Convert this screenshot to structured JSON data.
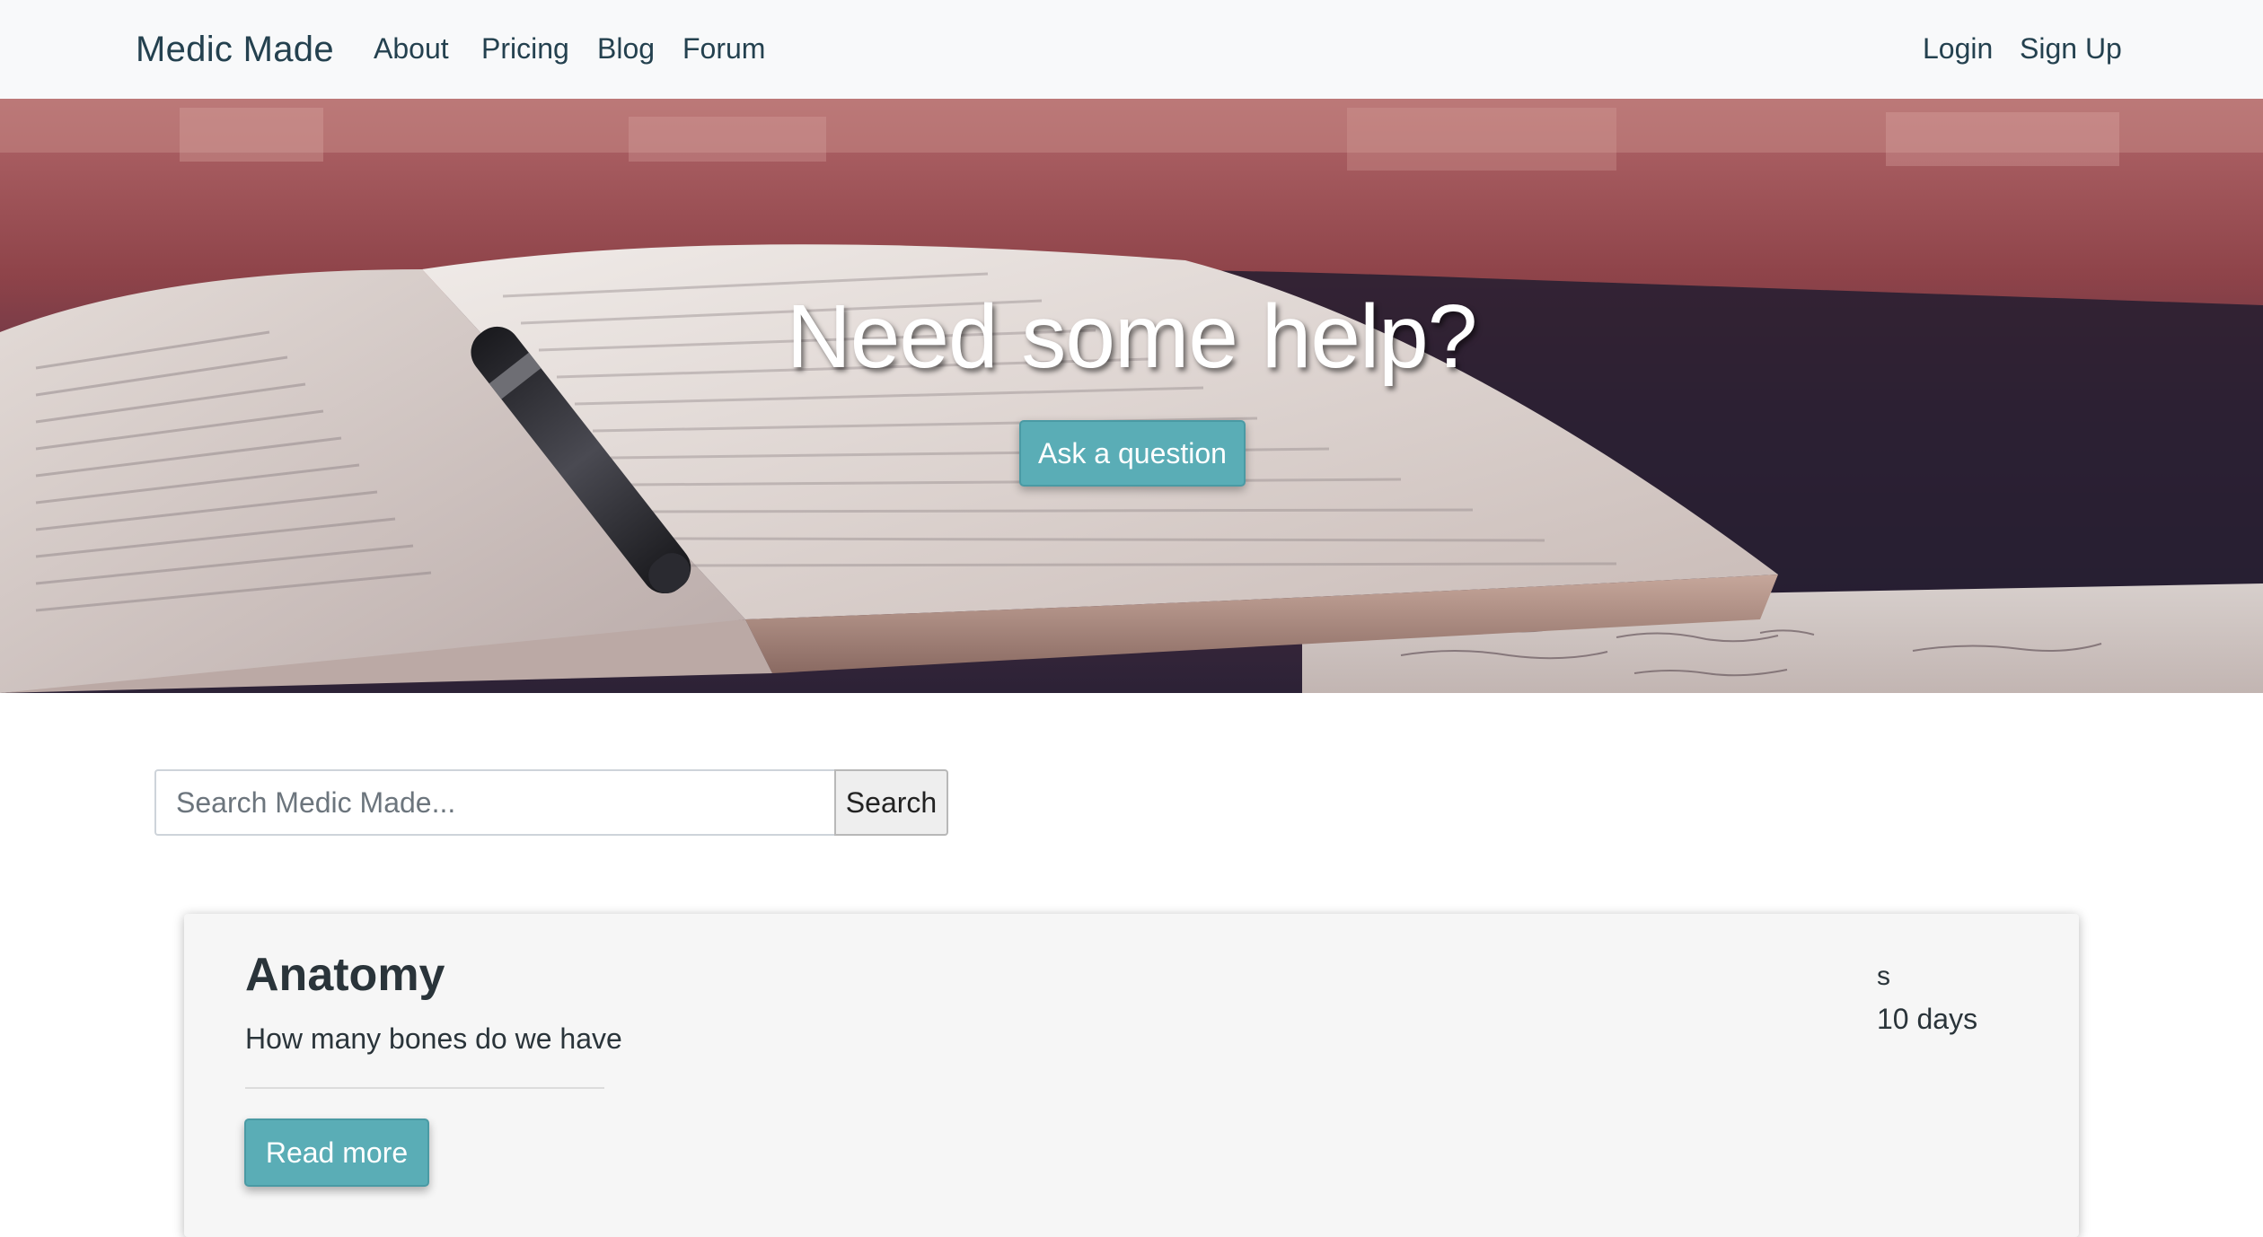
{
  "navbar": {
    "brand": "Medic Made",
    "links": [
      {
        "label": "About"
      },
      {
        "label": "Pricing"
      },
      {
        "label": "Blog"
      },
      {
        "label": "Forum"
      }
    ],
    "auth": {
      "login": "Login",
      "signup": "Sign Up"
    }
  },
  "hero": {
    "title": "Need some help?",
    "button": "Ask a question"
  },
  "search": {
    "placeholder": "Search Medic Made...",
    "value": "",
    "button": "Search"
  },
  "posts": [
    {
      "title": "Anatomy",
      "body": "How many bones do we have",
      "button": "Read more",
      "meta_author": "s",
      "meta_age": "10 days"
    }
  ],
  "colors": {
    "accent": "#5aadb6",
    "navbar_bg": "#f8f9fa",
    "text": "#24414f"
  }
}
